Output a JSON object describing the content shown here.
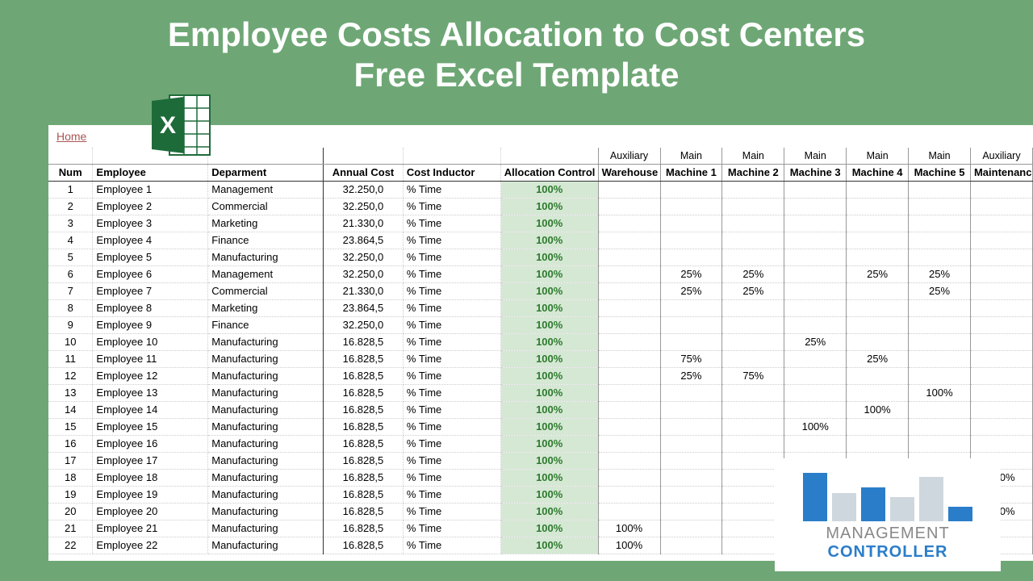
{
  "title_line1": "Employee Costs Allocation to Cost Centers",
  "title_line2": "Free Excel Template",
  "home_link": "Home",
  "headers": {
    "num": "Num",
    "employee": "Employee",
    "department": "Deparment",
    "annual_cost": "Annual Cost",
    "cost_inductor": "Cost Inductor",
    "allocation": "Allocation Control"
  },
  "cost_center_categories": [
    "Auxiliary",
    "Main",
    "Main",
    "Main",
    "Main",
    "Main",
    "Auxiliary"
  ],
  "cost_centers": [
    "Warehouse",
    "Machine 1",
    "Machine 2",
    "Machine 3",
    "Machine 4",
    "Machine 5",
    "Maintenance"
  ],
  "rows": [
    {
      "num": "1",
      "emp": "Employee 1",
      "dep": "Management",
      "cost": "32.250,0",
      "ind": "% Time",
      "alloc": "100%",
      "cc": [
        "",
        "",
        "",
        "",
        "",
        "",
        ""
      ]
    },
    {
      "num": "2",
      "emp": "Employee 2",
      "dep": "Commercial",
      "cost": "32.250,0",
      "ind": "% Time",
      "alloc": "100%",
      "cc": [
        "",
        "",
        "",
        "",
        "",
        "",
        ""
      ]
    },
    {
      "num": "3",
      "emp": "Employee 3",
      "dep": "Marketing",
      "cost": "21.330,0",
      "ind": "% Time",
      "alloc": "100%",
      "cc": [
        "",
        "",
        "",
        "",
        "",
        "",
        ""
      ]
    },
    {
      "num": "4",
      "emp": "Employee 4",
      "dep": "Finance",
      "cost": "23.864,5",
      "ind": "% Time",
      "alloc": "100%",
      "cc": [
        "",
        "",
        "",
        "",
        "",
        "",
        ""
      ]
    },
    {
      "num": "5",
      "emp": "Employee 5",
      "dep": "Manufacturing",
      "cost": "32.250,0",
      "ind": "% Time",
      "alloc": "100%",
      "cc": [
        "",
        "",
        "",
        "",
        "",
        "",
        ""
      ]
    },
    {
      "num": "6",
      "emp": "Employee 6",
      "dep": "Management",
      "cost": "32.250,0",
      "ind": "% Time",
      "alloc": "100%",
      "cc": [
        "",
        "25%",
        "25%",
        "",
        "25%",
        "25%",
        ""
      ]
    },
    {
      "num": "7",
      "emp": "Employee 7",
      "dep": "Commercial",
      "cost": "21.330,0",
      "ind": "% Time",
      "alloc": "100%",
      "cc": [
        "",
        "25%",
        "25%",
        "",
        "",
        "25%",
        ""
      ]
    },
    {
      "num": "8",
      "emp": "Employee 8",
      "dep": "Marketing",
      "cost": "23.864,5",
      "ind": "% Time",
      "alloc": "100%",
      "cc": [
        "",
        "",
        "",
        "",
        "",
        "",
        ""
      ]
    },
    {
      "num": "9",
      "emp": "Employee 9",
      "dep": "Finance",
      "cost": "32.250,0",
      "ind": "% Time",
      "alloc": "100%",
      "cc": [
        "",
        "",
        "",
        "",
        "",
        "",
        ""
      ]
    },
    {
      "num": "10",
      "emp": "Employee 10",
      "dep": "Manufacturing",
      "cost": "16.828,5",
      "ind": "% Time",
      "alloc": "100%",
      "cc": [
        "",
        "",
        "",
        "25%",
        "",
        "",
        ""
      ]
    },
    {
      "num": "11",
      "emp": "Employee 11",
      "dep": "Manufacturing",
      "cost": "16.828,5",
      "ind": "% Time",
      "alloc": "100%",
      "cc": [
        "",
        "75%",
        "",
        "",
        "25%",
        "",
        ""
      ]
    },
    {
      "num": "12",
      "emp": "Employee 12",
      "dep": "Manufacturing",
      "cost": "16.828,5",
      "ind": "% Time",
      "alloc": "100%",
      "cc": [
        "",
        "25%",
        "75%",
        "",
        "",
        "",
        ""
      ]
    },
    {
      "num": "13",
      "emp": "Employee 13",
      "dep": "Manufacturing",
      "cost": "16.828,5",
      "ind": "% Time",
      "alloc": "100%",
      "cc": [
        "",
        "",
        "",
        "",
        "",
        "100%",
        ""
      ]
    },
    {
      "num": "14",
      "emp": "Employee 14",
      "dep": "Manufacturing",
      "cost": "16.828,5",
      "ind": "% Time",
      "alloc": "100%",
      "cc": [
        "",
        "",
        "",
        "",
        "100%",
        "",
        ""
      ]
    },
    {
      "num": "15",
      "emp": "Employee 15",
      "dep": "Manufacturing",
      "cost": "16.828,5",
      "ind": "% Time",
      "alloc": "100%",
      "cc": [
        "",
        "",
        "",
        "100%",
        "",
        "",
        ""
      ]
    },
    {
      "num": "16",
      "emp": "Employee 16",
      "dep": "Manufacturing",
      "cost": "16.828,5",
      "ind": "% Time",
      "alloc": "100%",
      "cc": [
        "",
        "",
        "",
        "",
        "",
        "",
        ""
      ]
    },
    {
      "num": "17",
      "emp": "Employee 17",
      "dep": "Manufacturing",
      "cost": "16.828,5",
      "ind": "% Time",
      "alloc": "100%",
      "cc": [
        "",
        "",
        "",
        "",
        "",
        "",
        ""
      ]
    },
    {
      "num": "18",
      "emp": "Employee 18",
      "dep": "Manufacturing",
      "cost": "16.828,5",
      "ind": "% Time",
      "alloc": "100%",
      "cc": [
        "",
        "",
        "",
        "",
        "",
        "",
        "100%"
      ]
    },
    {
      "num": "19",
      "emp": "Employee 19",
      "dep": "Manufacturing",
      "cost": "16.828,5",
      "ind": "% Time",
      "alloc": "100%",
      "cc": [
        "",
        "",
        "",
        "",
        "",
        "",
        ""
      ]
    },
    {
      "num": "20",
      "emp": "Employee 20",
      "dep": "Manufacturing",
      "cost": "16.828,5",
      "ind": "% Time",
      "alloc": "100%",
      "cc": [
        "",
        "",
        "",
        "",
        "",
        "",
        "100%"
      ]
    },
    {
      "num": "21",
      "emp": "Employee 21",
      "dep": "Manufacturing",
      "cost": "16.828,5",
      "ind": "% Time",
      "alloc": "100%",
      "cc": [
        "100%",
        "",
        "",
        "",
        "",
        "",
        ""
      ]
    },
    {
      "num": "22",
      "emp": "Employee 22",
      "dep": "Manufacturing",
      "cost": "16.828,5",
      "ind": "% Time",
      "alloc": "100%",
      "cc": [
        "100%",
        "",
        "",
        "",
        "",
        "",
        ""
      ]
    }
  ],
  "logo": {
    "line1": "MANAGEMENT",
    "line2": "CONTROLLER"
  }
}
